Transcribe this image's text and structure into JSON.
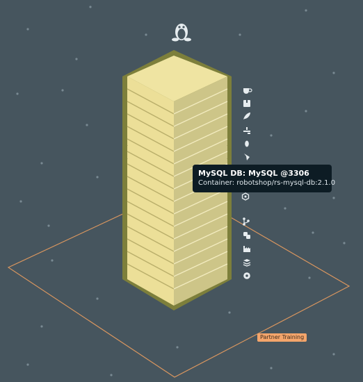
{
  "tooltip": {
    "title": "MySQL DB: MySQL @3306",
    "subtitle": "Container: robotshop/rs-mysql-db:2.1.0"
  },
  "zone": {
    "label": "Partner Training",
    "color": "#f4a56b"
  },
  "colors": {
    "background": "#46555e",
    "block_face": "#e9dd97",
    "block_side": "#cfc787",
    "block_border": "#7d7f3b",
    "tooltip_bg": "#0d1c24"
  },
  "icons": [
    "coffee-icon",
    "package-icon",
    "feather-icon",
    "hands-icon",
    "pill-icon",
    "leaf-icon",
    "hexagon-icon",
    "git-branch-icon",
    "python-icon",
    "factory-icon",
    "stack-icon",
    "gear-icon",
    "linux-icon"
  ]
}
